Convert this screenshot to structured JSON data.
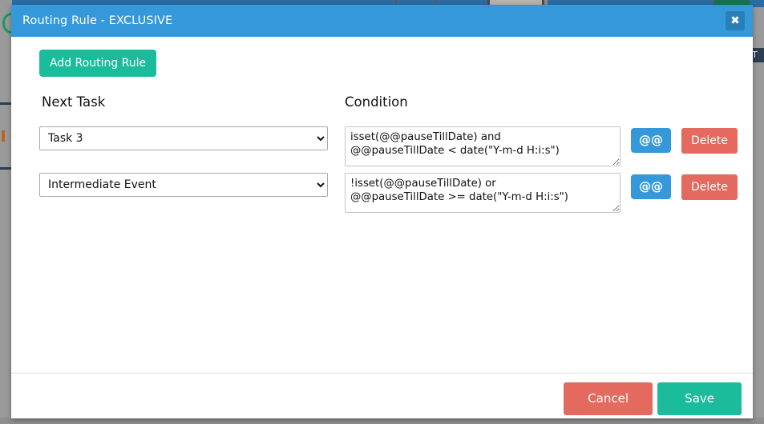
{
  "window": {
    "title": "Routing Rule - EXCLUSIVE",
    "close_icon": "close-icon",
    "close_glyph": "✖"
  },
  "colors": {
    "header_blue": "#3498db",
    "close_blue": "#2980b9",
    "teal": "#1abc9c",
    "red": "#e4695e",
    "page_gray": "#8c8c8c",
    "text": "#111111"
  },
  "toolbar": {
    "add_rule_label": "Add Routing Rule"
  },
  "table": {
    "headers": {
      "next_task": "Next Task",
      "condition": "Condition"
    },
    "rows": [
      {
        "next_task": "Task 3",
        "condition": "isset(@@pauseTillDate) and\n@@pauseTillDate < date(\"Y-m-d H:i:s\")",
        "at_label": "@@",
        "delete_label": "Delete"
      },
      {
        "next_task": "Intermediate Event",
        "condition": "!isset(@@pauseTillDate) or\n@@pauseTillDate >= date(\"Y-m-d H:i:s\")",
        "at_label": "@@",
        "delete_label": "Delete"
      }
    ],
    "task_options": [
      "Task 3",
      "Intermediate Event"
    ]
  },
  "footer": {
    "cancel_label": "Cancel",
    "save_label": "Save"
  },
  "background": {
    "right_rail_text": "T"
  }
}
